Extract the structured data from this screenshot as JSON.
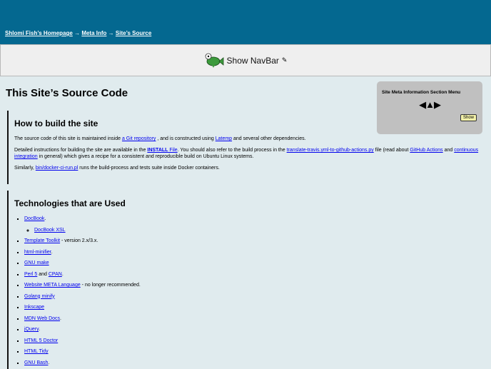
{
  "breadcrumb": {
    "items": [
      "Shlomi Fish’s Homepage",
      "Meta Info",
      "Site’s Source"
    ],
    "sep": "→"
  },
  "navbar": {
    "label": "Show NavBar",
    "edit_icon": "✎"
  },
  "page_title": "This Site’s Source Code",
  "menu": {
    "title": "Site Meta Information Section Menu",
    "prev": "◀",
    "up": "▲",
    "next": "▶",
    "show": "Show"
  },
  "build": {
    "heading": "How to build the site",
    "p1": {
      "t1": "The source code of this site is maintained inside ",
      "l1": "a Git repository",
      "t2": " , and is constructed using ",
      "l2": "Latemp",
      "t3": " and several other dependencies."
    },
    "p2": {
      "t1": "Detailed instructions for building the site are available in the ",
      "l1": "INSTALL",
      "l1b": " File",
      "t2": ". You should also refer to the build process in the ",
      "l2": "translate-travis.yml-to-github-actions.py",
      "t3": " file (read about ",
      "l3": "GitHub Actions",
      "t4": " and ",
      "l4": "continuous integration",
      "t5": " in general) which gives a recipe for a consistent and reproducible build on Ubuntu Linux systems."
    },
    "p3": {
      "t1": "Similarly, ",
      "l1": "bin/docker-ci-run.pl",
      "t2": " runs the build-process and tests suite inside Docker containers."
    }
  },
  "tech": {
    "heading": "Technologies that are Used",
    "items": [
      {
        "link": "DocBook",
        "suffix": ".",
        "sub": "DocBook XSL"
      },
      {
        "link": "Template Toolkit",
        "suffix": " - version 2.x/3.x."
      },
      {
        "link": "html-minifier",
        "suffix": "."
      },
      {
        "link": "GNU make",
        "suffix": ""
      },
      {
        "link": "Perl 5",
        "suffix": " and ",
        "link2": "CPAN",
        "suffix2": "."
      },
      {
        "link": "Website META Language",
        "suffix": " - no longer recommended."
      },
      {
        "link": "Golang minify",
        "suffix": ""
      },
      {
        "link": "Inkscape",
        "suffix": ""
      },
      {
        "link": "MDN Web Docs",
        "suffix": "."
      },
      {
        "link": "jQuery",
        "suffix": "."
      },
      {
        "link": "HTML 5 Doctor",
        "suffix": ""
      },
      {
        "link": "HTML Tidy",
        "suffix": ""
      },
      {
        "link": "GNU Bash",
        "suffix": "."
      }
    ]
  }
}
